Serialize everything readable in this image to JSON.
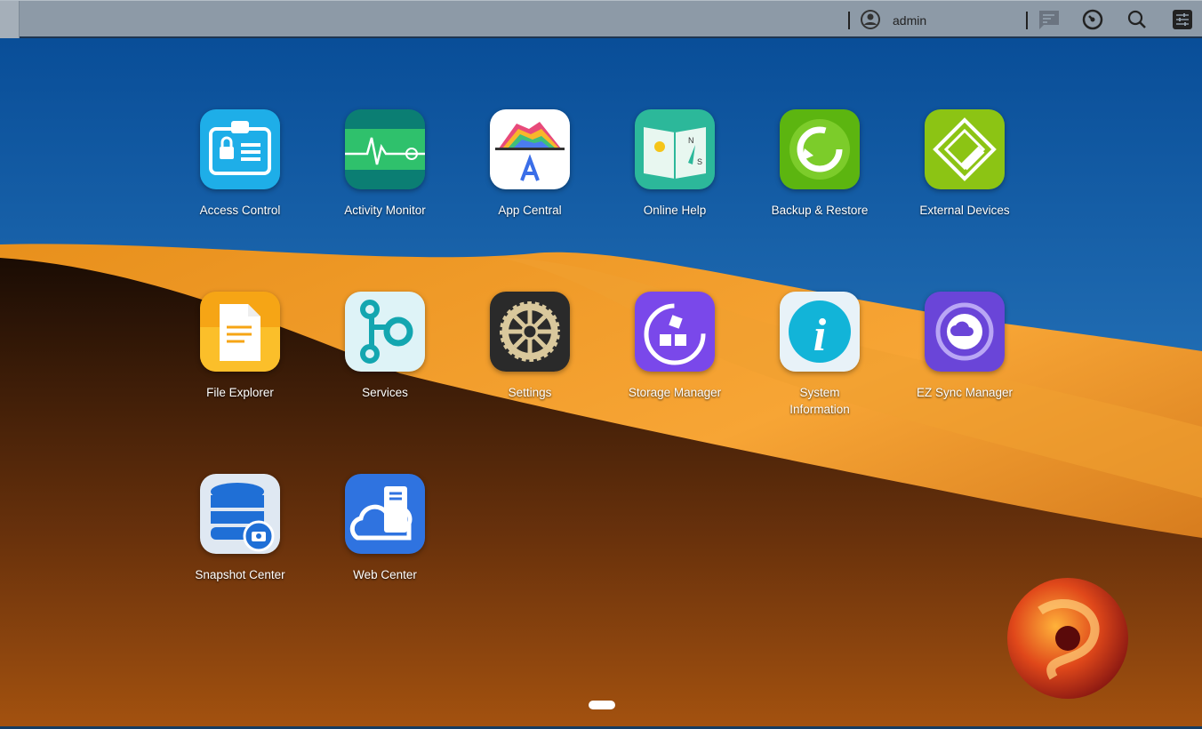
{
  "topbar": {
    "user": "admin",
    "icons": [
      "user-icon",
      "notification-icon",
      "dashboard-gauge-icon",
      "search-icon",
      "settings-sliders-icon"
    ]
  },
  "apps": [
    {
      "label": "Access Control",
      "icon": "access-control-icon"
    },
    {
      "label": "Activity Monitor",
      "icon": "activity-monitor-icon"
    },
    {
      "label": "App Central",
      "icon": "app-central-icon"
    },
    {
      "label": "Online Help",
      "icon": "online-help-icon"
    },
    {
      "label": "Backup & Restore",
      "icon": "backup-restore-icon"
    },
    {
      "label": "External Devices",
      "icon": "external-devices-icon"
    },
    {
      "label": "File Explorer",
      "icon": "file-explorer-icon"
    },
    {
      "label": "Services",
      "icon": "services-icon"
    },
    {
      "label": "Settings",
      "icon": "settings-gear-icon"
    },
    {
      "label": "Storage Manager",
      "icon": "storage-manager-icon"
    },
    {
      "label": "System Information",
      "icon": "system-information-icon"
    },
    {
      "label": "EZ Sync Manager",
      "icon": "ez-sync-icon"
    },
    {
      "label": "Snapshot Center",
      "icon": "snapshot-center-icon"
    },
    {
      "label": "Web Center",
      "icon": "web-center-icon"
    }
  ],
  "pager": {
    "current_page": 1,
    "total_pages": 1
  }
}
